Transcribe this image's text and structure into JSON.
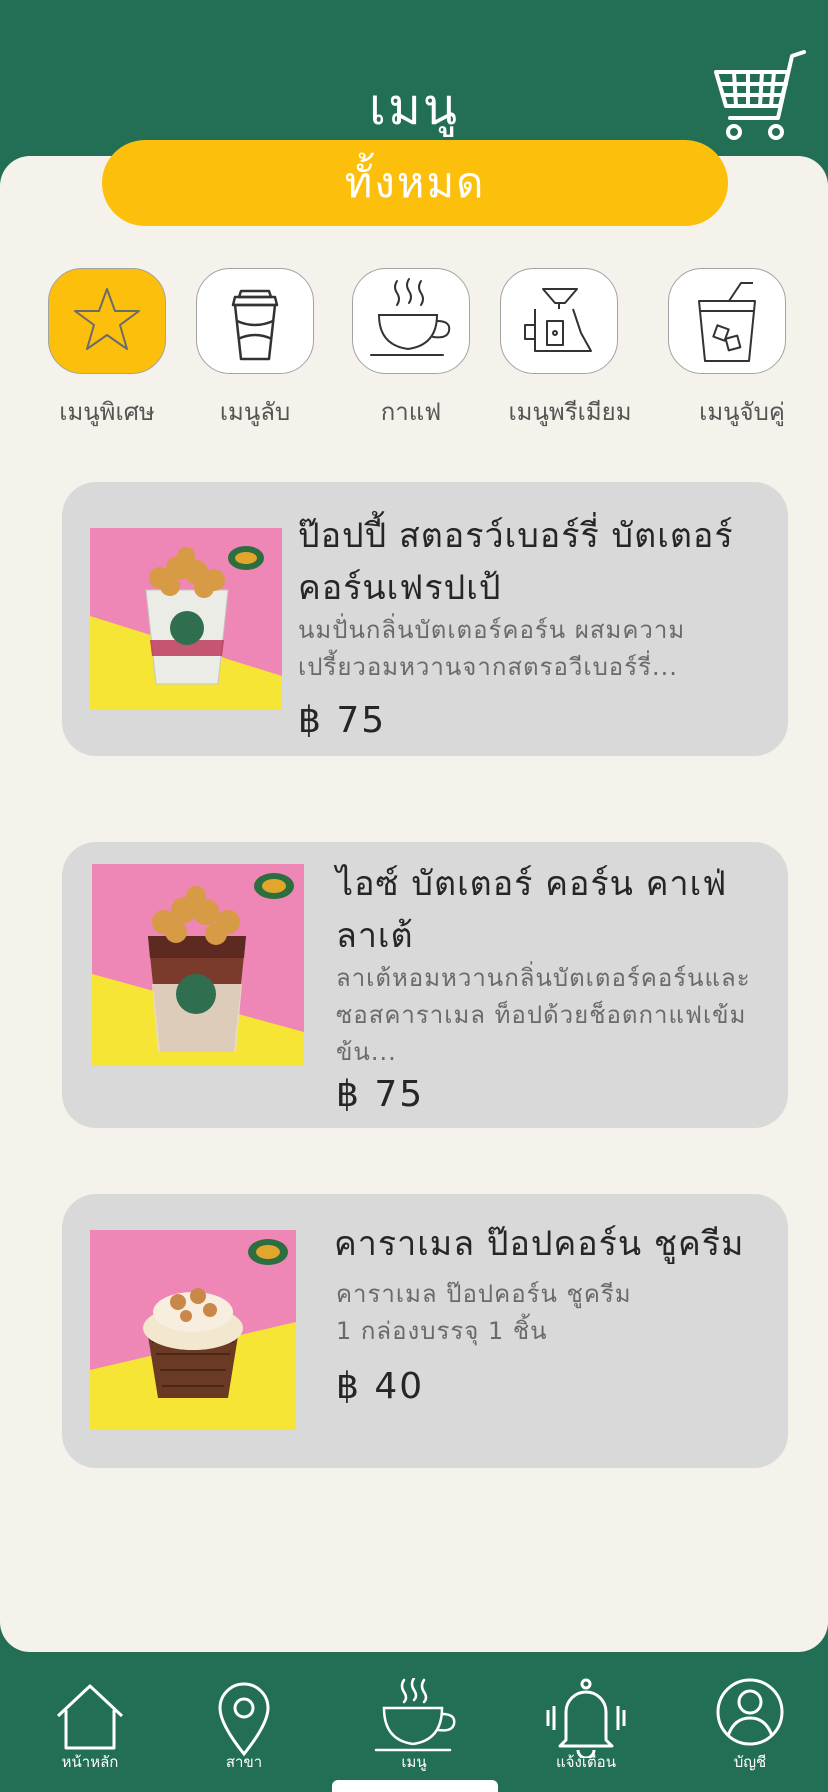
{
  "header": {
    "title": "เมนู",
    "cart_icon": "shopping-cart-icon"
  },
  "filter": {
    "all_label": "ทั้งหมด"
  },
  "categories": [
    {
      "label": "เมนูพิเศษ",
      "icon": "star-icon",
      "active": true
    },
    {
      "label": "เมนูลับ",
      "icon": "takeaway-cup-icon",
      "active": false
    },
    {
      "label": "กาแฟ",
      "icon": "hot-coffee-icon",
      "active": false
    },
    {
      "label": "เมนูพรีเมียม",
      "icon": "drip-coffee-icon",
      "active": false
    },
    {
      "label": "เมนูจับคู่",
      "icon": "iced-drink-icon",
      "active": false
    }
  ],
  "products": [
    {
      "title_line1": "ป๊อปปี้ สตอรว์เบอร์รี่ บัตเตอร์",
      "title_line2": "คอร์นเฟรปเป้",
      "desc_line1": "นมปั่นกลิ่นบัตเตอร์คอร์น ผสมความ",
      "desc_line2": "เปรี้ยวอมหวานจากสตรอวีเบอร์รี่...",
      "price": "฿ 75"
    },
    {
      "title_line1": "ไอซ์ บัตเตอร์ คอร์น คาเฟ่",
      "title_line2": "ลาเต้",
      "desc_line1": "ลาเต้หอมหวานกลิ่นบัตเตอร์คอร์นและ",
      "desc_line2": "ซอสคาราเมล ท็อปด้วยช็อตกาแฟเข้ม",
      "desc_line3": "ข้น...",
      "price": "฿ 75"
    },
    {
      "title_line1": "คาราเมล ป๊อปคอร์น ชูครีม",
      "desc_line1": "คาราเมล ป๊อปคอร์น ชูครีม",
      "desc_line2": "1 กล่องบรรจุ 1 ชิ้น",
      "price": "฿ 40"
    }
  ],
  "tabbar": [
    {
      "label": "หน้าหลัก",
      "icon": "home-icon"
    },
    {
      "label": "สาขา",
      "icon": "location-pin-icon"
    },
    {
      "label": "เมนู",
      "icon": "coffee-cup-icon",
      "active": true
    },
    {
      "label": "แจ้งเตือน",
      "icon": "bell-icon"
    },
    {
      "label": "บัญชี",
      "icon": "account-icon"
    }
  ],
  "colors": {
    "brand_green": "#236f55",
    "accent_yellow": "#fcbf0c",
    "background": "#f5f2ec",
    "card": "#d9d9d9"
  }
}
